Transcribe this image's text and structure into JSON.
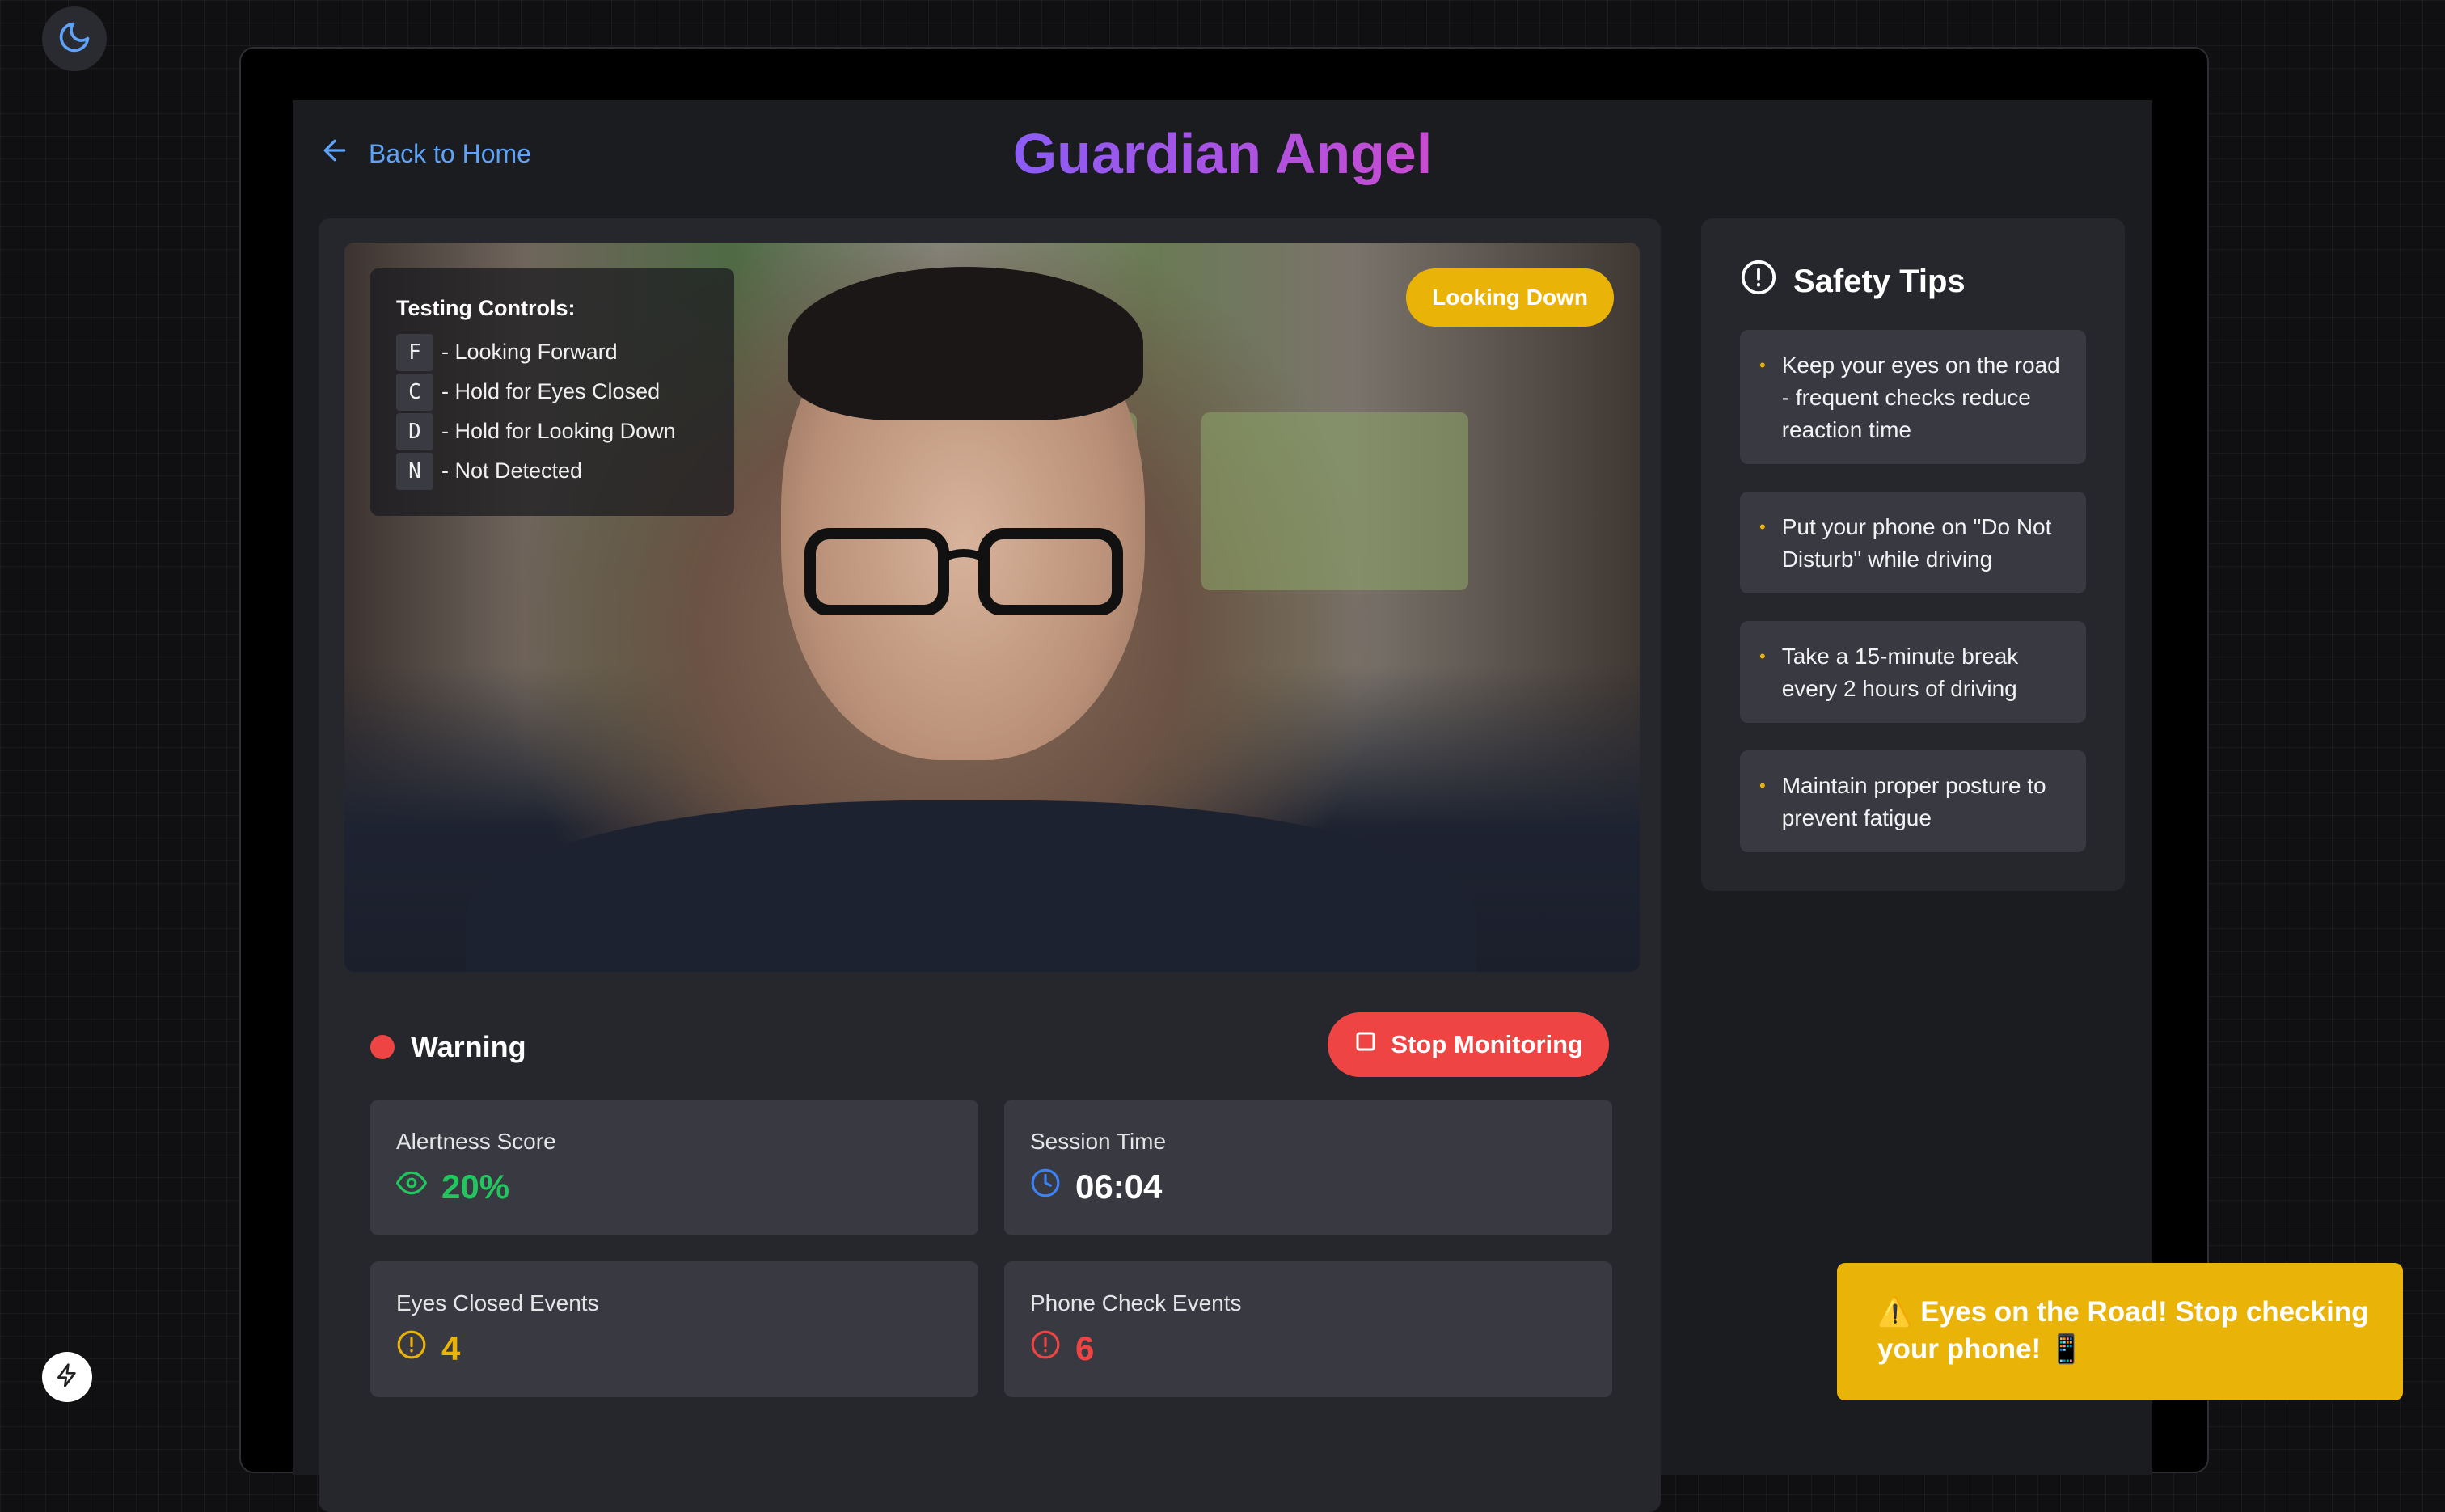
{
  "app": {
    "title": "Guardian Angel",
    "back_label": "Back to Home"
  },
  "video": {
    "status_badge": "Looking Down",
    "testing_controls": {
      "title": "Testing Controls:",
      "items": [
        {
          "key": "F",
          "label": "- Looking Forward"
        },
        {
          "key": "C",
          "label": "- Hold for Eyes Closed"
        },
        {
          "key": "D",
          "label": "- Hold for Looking Down"
        },
        {
          "key": "N",
          "label": "- Not Detected"
        }
      ]
    }
  },
  "status": {
    "label": "Warning",
    "stop_button": "Stop Monitoring"
  },
  "stats": {
    "alertness": {
      "label": "Alertness Score",
      "value": "20%",
      "icon": "eye-icon",
      "color": "#22c55e"
    },
    "session": {
      "label": "Session Time",
      "value": "06:04",
      "icon": "clock-icon",
      "color": "#ffffff"
    },
    "eyes_closed": {
      "label": "Eyes Closed Events",
      "value": "4",
      "icon": "alert-circle-icon",
      "color": "#eab308"
    },
    "phone_check": {
      "label": "Phone Check Events",
      "value": "6",
      "icon": "alert-circle-icon",
      "color": "#ef4444"
    }
  },
  "tips": {
    "title": "Safety Tips",
    "items": [
      "Keep your eyes on the road - frequent checks reduce reaction time",
      "Put your phone on \"Do Not Disturb\" while driving",
      "Take a 15-minute break every 2 hours of driving",
      "Maintain proper posture to prevent fatigue"
    ]
  },
  "toast": {
    "message": "⚠️ Eyes on the Road! Stop checking your phone! 📱"
  },
  "colors": {
    "accent_blue": "#5ea3f7",
    "warning_yellow": "#eab308",
    "danger_red": "#ef4444",
    "success_green": "#22c55e",
    "title_gradient": [
      "#8b5cf6",
      "#c84bd0"
    ]
  }
}
